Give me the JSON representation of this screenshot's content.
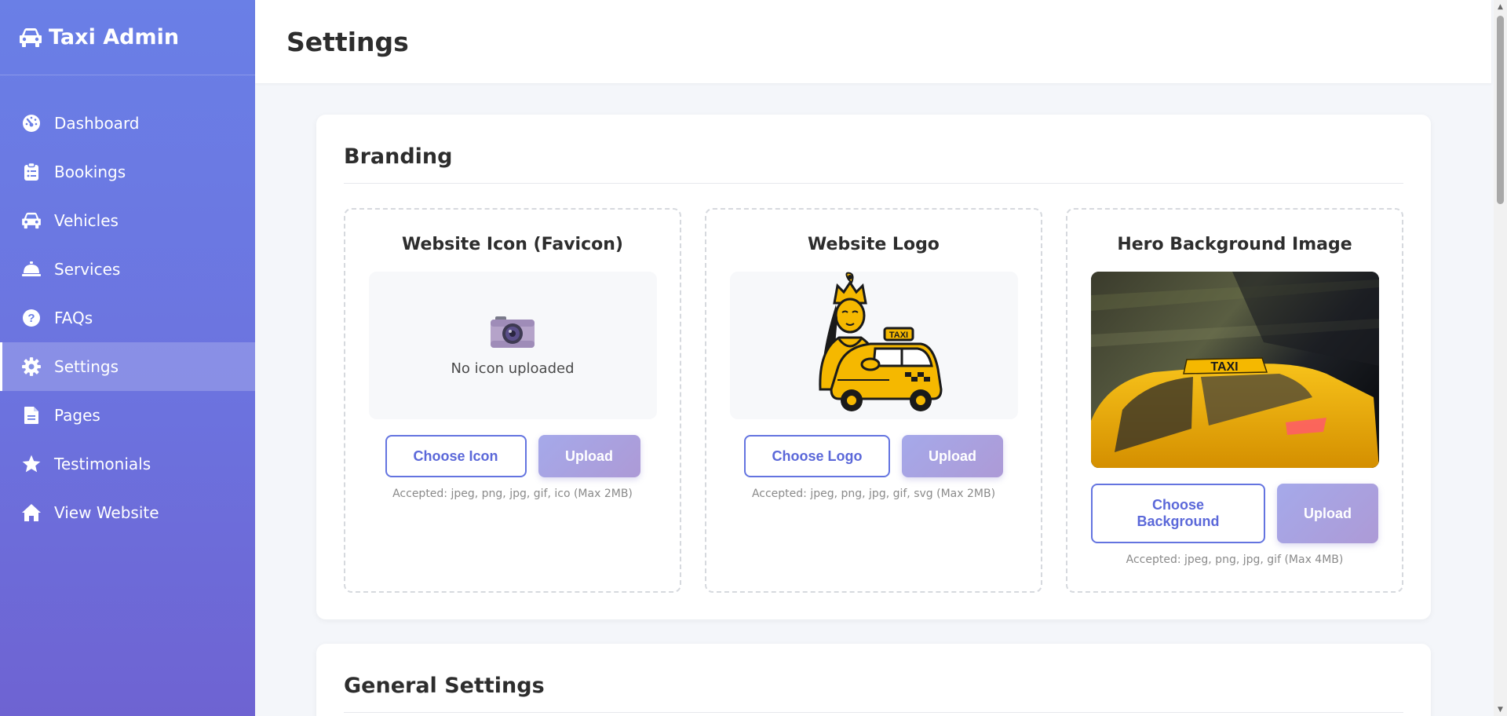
{
  "app": {
    "brand": "Taxi Admin",
    "brand_icon": "car-icon"
  },
  "sidebar": {
    "items": [
      {
        "label": "Dashboard",
        "icon": "gauge-icon",
        "active": false
      },
      {
        "label": "Bookings",
        "icon": "clipboard-icon",
        "active": false
      },
      {
        "label": "Vehicles",
        "icon": "car-icon",
        "active": false
      },
      {
        "label": "Services",
        "icon": "concierge-bell-icon",
        "active": false
      },
      {
        "label": "FAQs",
        "icon": "question-circle-icon",
        "active": false
      },
      {
        "label": "Settings",
        "icon": "gear-icon",
        "active": true
      },
      {
        "label": "Pages",
        "icon": "file-icon",
        "active": false
      },
      {
        "label": "Testimonials",
        "icon": "star-icon",
        "active": false
      },
      {
        "label": "View Website",
        "icon": "home-icon",
        "active": false
      }
    ]
  },
  "header": {
    "title": "Settings"
  },
  "branding": {
    "title": "Branding",
    "favicon": {
      "title": "Website Icon (Favicon)",
      "empty_text": "No icon uploaded",
      "choose_label": "Choose Icon",
      "upload_label": "Upload",
      "accepted": "Accepted: jpeg, png, jpg, gif, ico (Max 2MB)"
    },
    "logo": {
      "title": "Website Logo",
      "logo_text": "TAXI",
      "choose_label": "Choose Logo",
      "upload_label": "Upload",
      "accepted": "Accepted: jpeg, png, jpg, gif, svg (Max 2MB)"
    },
    "hero": {
      "title": "Hero Background Image",
      "sign_text": "TAXI",
      "choose_label_line1": "Choose",
      "choose_label_line2": "Background",
      "upload_label": "Upload",
      "accepted": "Accepted: jpeg, png, jpg, gif (Max 4MB)"
    }
  },
  "general": {
    "title": "General Settings"
  },
  "colors": {
    "accent": "#6474e0",
    "sidebar_top": "#6a7fe6",
    "sidebar_bottom": "#6e63d2",
    "taxi_yellow": "#f5b800"
  }
}
